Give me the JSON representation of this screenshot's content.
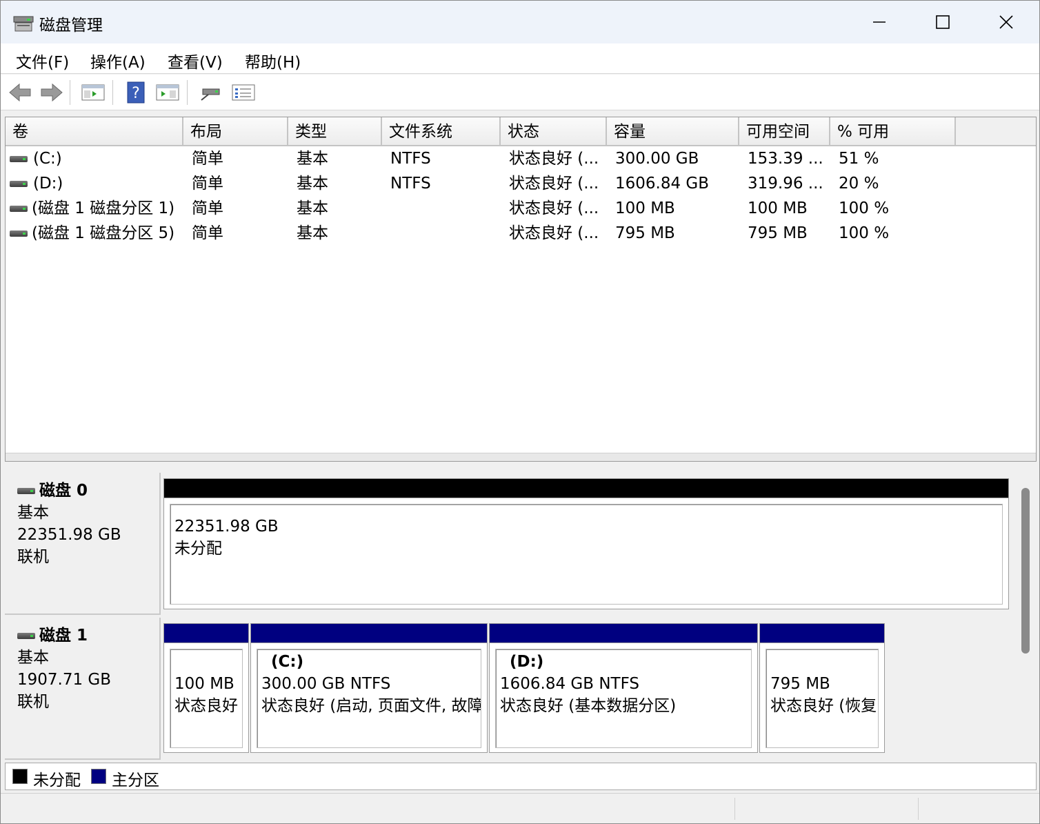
{
  "window": {
    "title": "磁盘管理",
    "icon": "disk-management-icon"
  },
  "menu": [
    {
      "label": "文件(F)"
    },
    {
      "label": "操作(A)"
    },
    {
      "label": "查看(V)"
    },
    {
      "label": "帮助(H)"
    }
  ],
  "toolbar": [
    "back-arrow-icon",
    "forward-arrow-icon",
    "show-hide-console-tree-icon",
    "help-icon",
    "show-action-pane-icon",
    "connect-drive-icon",
    "properties-list-icon"
  ],
  "columns": [
    "卷",
    "布局",
    "类型",
    "文件系统",
    "状态",
    "容量",
    "可用空间",
    "% 可用"
  ],
  "volumes": [
    {
      "name": "(C:)",
      "layout": "简单",
      "type": "基本",
      "fs": "NTFS",
      "status": "状态良好 (...",
      "capacity": "300.00 GB",
      "free": "153.39 ...",
      "pct": "51 %"
    },
    {
      "name": "(D:)",
      "layout": "简单",
      "type": "基本",
      "fs": "NTFS",
      "status": "状态良好 (...",
      "capacity": "1606.84 GB",
      "free": "319.96 ...",
      "pct": "20 %"
    },
    {
      "name": "(磁盘 1 磁盘分区 1)",
      "layout": "简单",
      "type": "基本",
      "fs": "",
      "status": "状态良好 (...",
      "capacity": "100 MB",
      "free": "100 MB",
      "pct": "100 %"
    },
    {
      "name": "(磁盘 1 磁盘分区 5)",
      "layout": "简单",
      "type": "基本",
      "fs": "",
      "status": "状态良好 (...",
      "capacity": "795 MB",
      "free": "795 MB",
      "pct": "100 %"
    }
  ],
  "disks": [
    {
      "name": "磁盘 0",
      "type": "基本",
      "size": "22351.98 GB",
      "state": "联机",
      "partitions": [
        {
          "title": "",
          "line1": "22351.98 GB",
          "line2": "未分配",
          "color": "#000000"
        }
      ]
    },
    {
      "name": "磁盘 1",
      "type": "基本",
      "size": "1907.71 GB",
      "state": "联机",
      "partitions": [
        {
          "title": "",
          "line1": "100 MB",
          "line2": "状态良好",
          "color": "#000080"
        },
        {
          "title": "(C:)",
          "line1": "300.00 GB NTFS",
          "line2": "状态良好 (启动, 页面文件, 故障",
          "color": "#000080"
        },
        {
          "title": "(D:)",
          "line1": "1606.84 GB NTFS",
          "line2": "状态良好 (基本数据分区)",
          "color": "#000080"
        },
        {
          "title": "",
          "line1": "795 MB",
          "line2": "状态良好 (恢复",
          "color": "#000080"
        }
      ]
    }
  ],
  "legend": [
    {
      "label": "未分配",
      "color": "#000000"
    },
    {
      "label": "主分区",
      "color": "#000080"
    }
  ]
}
